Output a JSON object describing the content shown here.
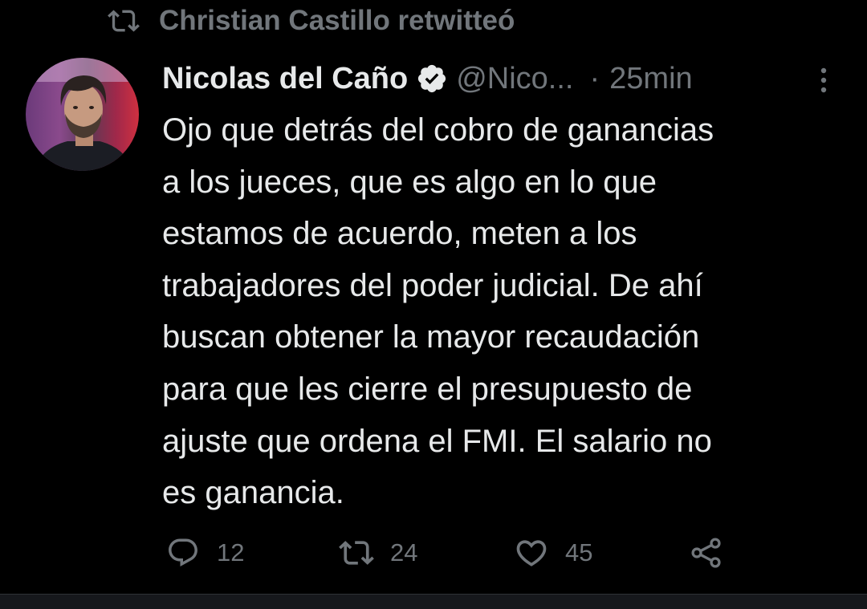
{
  "retweet_context": {
    "text": "Christian Castillo retwitteó",
    "icon": "retweet-icon"
  },
  "tweet": {
    "author_name": "Nicolas del Caño",
    "verified_icon": "verified-badge-icon",
    "handle": "@Nico...",
    "separator": "·",
    "time": "25min",
    "text": "Ojo que detrás del cobro de ganancias\na los jueces, que es algo en lo que\nestamos de acuerdo, meten a los\ntrabajadores del poder judicial. De ahí\nbuscan obtener la mayor recaudación\npara que les cierre el presupuesto de\najuste que ordena el FMI. El salario no\nes ganancia.",
    "more_icon": "more-options-icon"
  },
  "actions": {
    "reply": {
      "icon": "reply-icon",
      "count": "12"
    },
    "retweet": {
      "icon": "retweet-icon",
      "count": "24"
    },
    "like": {
      "icon": "heart-icon",
      "count": "45"
    },
    "share": {
      "icon": "share-icon"
    }
  },
  "colors": {
    "background": "#000000",
    "primary_text": "#e7e9ea",
    "secondary_text": "#71767b"
  }
}
